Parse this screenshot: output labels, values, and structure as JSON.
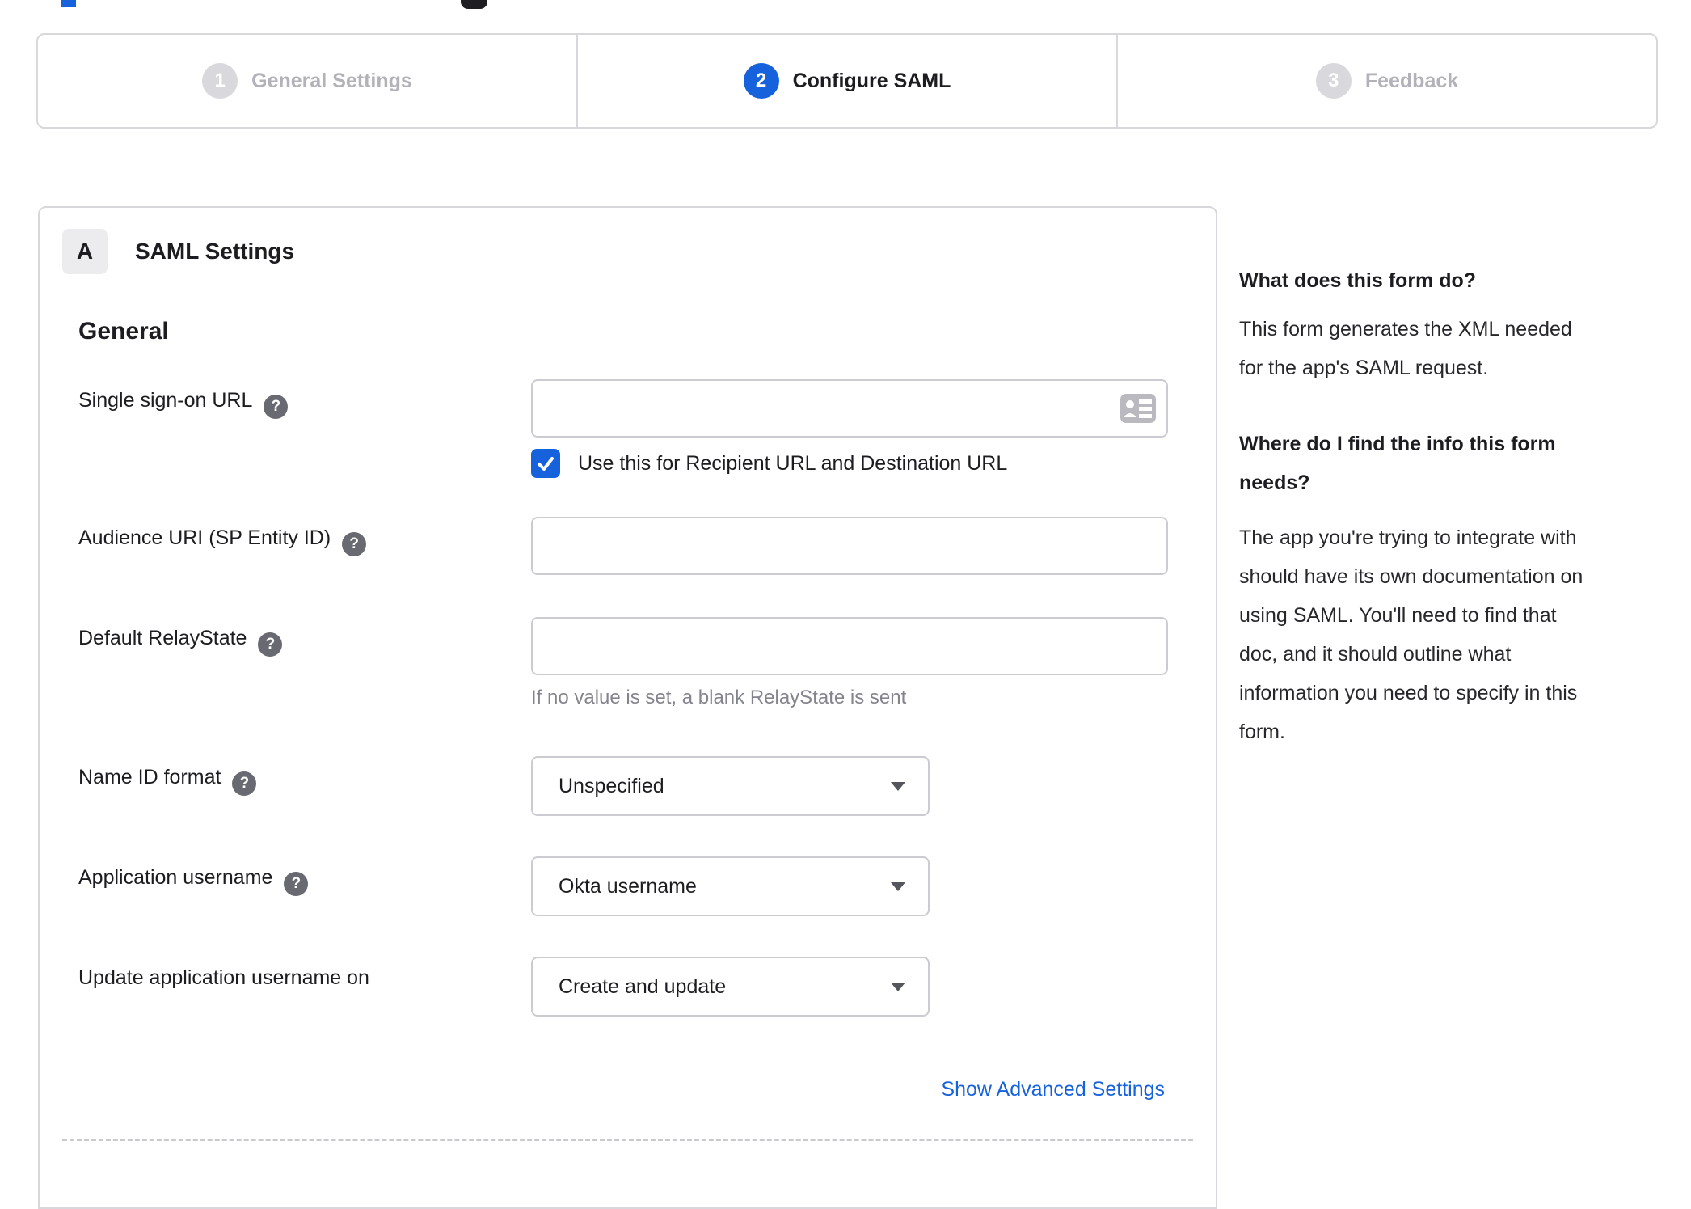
{
  "top": {
    "accent_sliver": "#1662dd",
    "dark_shape": "#1e1e22"
  },
  "steps": [
    {
      "number": "1",
      "label": "General Settings",
      "state": "inactive"
    },
    {
      "number": "2",
      "label": "Configure SAML",
      "state": "active"
    },
    {
      "number": "3",
      "label": "Feedback",
      "state": "inactive"
    }
  ],
  "panel": {
    "badge": "A",
    "title": "SAML Settings",
    "section_heading": "General",
    "fields": {
      "sso": {
        "label": "Single sign-on URL",
        "value": "",
        "has_help": true,
        "checkbox_label": "Use this for Recipient URL and Destination URL",
        "checkbox_checked": true
      },
      "audience": {
        "label": "Audience URI (SP Entity ID)",
        "value": "",
        "has_help": true
      },
      "relay": {
        "label": "Default RelayState",
        "value": "",
        "has_help": true,
        "hint": "If no value is set, a blank RelayState is sent"
      },
      "nameid": {
        "label": "Name ID format",
        "value": "Unspecified",
        "has_help": true
      },
      "appuser": {
        "label": "Application username",
        "value": "Okta username",
        "has_help": true
      },
      "update": {
        "label": "Update application username on",
        "value": "Create and update",
        "has_help": false
      }
    },
    "advanced_link": "Show Advanced Settings",
    "help_glyph": "?"
  },
  "sidebar": {
    "s1_title": "What does this form do?",
    "s1_lines": [
      "This form generates the XML needed",
      "for the app's SAML request."
    ],
    "s2_title_lines": [
      "Where do I find the info this form",
      "needs?"
    ],
    "s2_lines": [
      "The app you're trying to integrate with",
      "should have its own documentation on",
      "using SAML. You'll need to find that",
      "doc, and it should outline what",
      "information you need to specify in this",
      "form."
    ]
  },
  "colors": {
    "accent": "#1662dd",
    "dark_text": "#1d1d21",
    "muted_step": "#b2b2b9",
    "border": "#d7d7dc",
    "hint": "#84848e"
  }
}
